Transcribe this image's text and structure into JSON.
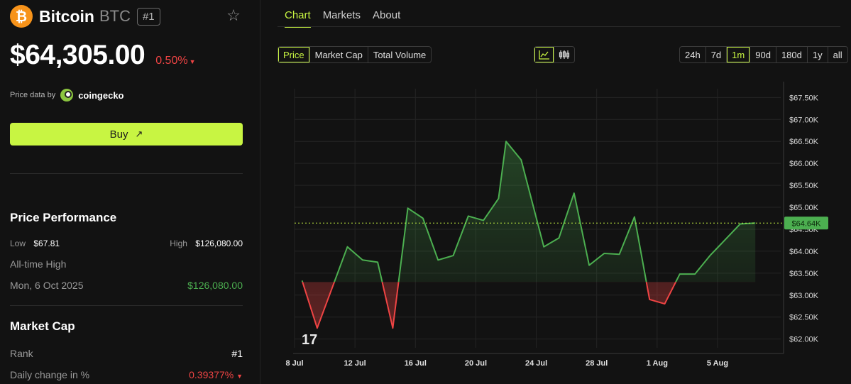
{
  "coin": {
    "logo_glyph": "₿",
    "name": "Bitcoin",
    "symbol": "BTC",
    "rank_badge": "#1",
    "price": "$64,305.00",
    "change": "0.50%",
    "change_arrow": "▼",
    "brand_color": "#f7931a"
  },
  "source": {
    "label": "Price data by",
    "provider": "coingecko"
  },
  "buy": {
    "label": "Buy",
    "arrow": "↗"
  },
  "performance": {
    "title": "Price Performance",
    "low_label": "Low",
    "low_value": "$67.81",
    "high_label": "High",
    "high_value": "$126,080.00",
    "ath_label": "All-time High",
    "ath_date": "Mon, 6 Oct 2025",
    "ath_value": "$126,080.00"
  },
  "market_cap": {
    "title": "Market Cap",
    "rank_label": "Rank",
    "rank_value": "#1",
    "daily_label": "Daily change in %",
    "daily_value": "0.39377%",
    "daily_arrow": "▼"
  },
  "tabs": [
    {
      "label": "Chart",
      "active": true
    },
    {
      "label": "Markets",
      "active": false
    },
    {
      "label": "About",
      "active": false
    }
  ],
  "metrics": [
    {
      "label": "Price",
      "active": true
    },
    {
      "label": "Market Cap",
      "active": false
    },
    {
      "label": "Total Volume",
      "active": false
    }
  ],
  "chart_types": [
    {
      "icon": "line-chart-icon",
      "active": true
    },
    {
      "icon": "candlestick-icon",
      "active": false
    }
  ],
  "ranges": [
    {
      "label": "24h",
      "active": false
    },
    {
      "label": "7d",
      "active": false
    },
    {
      "label": "1m",
      "active": true
    },
    {
      "label": "90d",
      "active": false
    },
    {
      "label": "180d",
      "active": false
    },
    {
      "label": "1y",
      "active": false
    },
    {
      "label": "all",
      "active": false
    }
  ],
  "chart_data": {
    "type": "line",
    "baseline": 63300,
    "current_label": "$64.64K",
    "current_value": 64640,
    "ylim": [
      61800,
      67700
    ],
    "yticks": [
      62000,
      62500,
      63000,
      63500,
      64000,
      64500,
      65000,
      65500,
      66000,
      66500,
      67000,
      67500
    ],
    "ytick_labels": [
      "$62.00K",
      "$62.50K",
      "$63.00K",
      "$63.50K",
      "$64.00K",
      "$64.50K",
      "$65.00K",
      "$65.50K",
      "$66.00K",
      "$66.50K",
      "$67.00K",
      "$67.50K"
    ],
    "xlim": [
      8,
      39.9
    ],
    "xticks": [
      8,
      12,
      16,
      20,
      24,
      28,
      32,
      36
    ],
    "xtick_labels": [
      "8 Jul",
      "12 Jul",
      "16 Jul",
      "20 Jul",
      "24 Jul",
      "28 Jul",
      "1 Aug",
      "5 Aug"
    ],
    "x": [
      8.5,
      9.5,
      11.5,
      12.5,
      13.5,
      14.5,
      15.5,
      16.5,
      17.5,
      18.5,
      19.5,
      20.5,
      21.5,
      22.0,
      23.0,
      24.5,
      25.5,
      26.5,
      27.5,
      28.5,
      29.5,
      30.5,
      31.5,
      32.5,
      33.5,
      34.5,
      35.5,
      37.5,
      38.5
    ],
    "y": [
      63330,
      62250,
      64100,
      63800,
      63750,
      62250,
      64980,
      64750,
      63800,
      63900,
      64800,
      64700,
      65200,
      66500,
      66080,
      64100,
      64300,
      65320,
      63680,
      63950,
      63930,
      64780,
      62900,
      62800,
      63480,
      63480,
      63900,
      64620,
      64640
    ],
    "colors": {
      "up": "#4caf50",
      "down": "#ef4444",
      "accent": "#c8f542"
    },
    "watermark": "17"
  }
}
